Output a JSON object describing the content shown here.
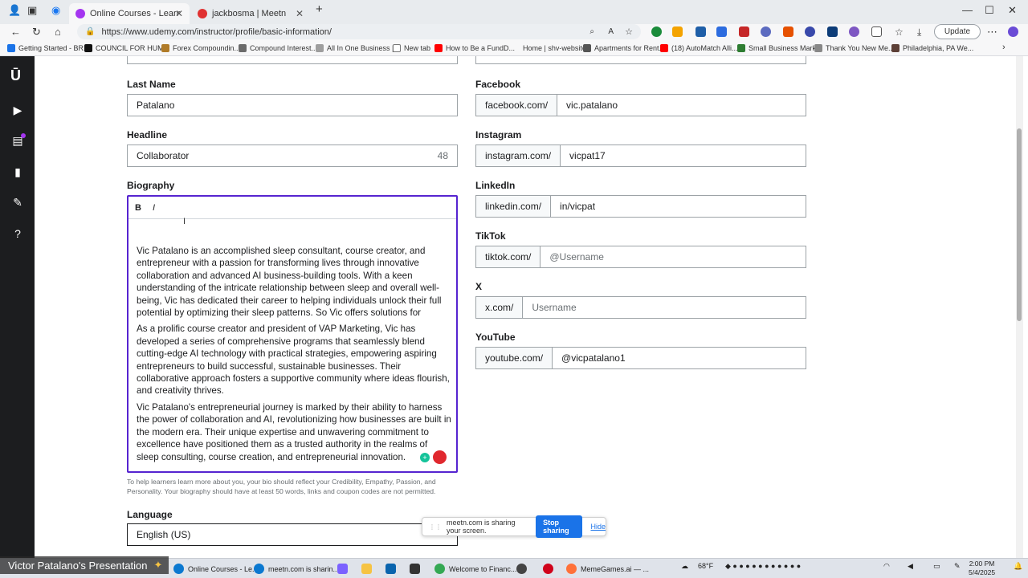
{
  "browser": {
    "tabs": [
      {
        "title": "Online Courses - Learn Anything,",
        "active": true
      },
      {
        "title": "jackbosma | Meetn",
        "active": false
      }
    ],
    "url": "https://www.udemy.com/instructor/profile/basic-information/",
    "update_label": "Update",
    "bookmarks": [
      "Getting Started - BR...",
      "COUNCIL FOR HUM...",
      "Forex Compoundin...",
      "Compound Interest...",
      "All In One Business |...",
      "New tab",
      "How to Be a FundD...",
      "Home | shv-website",
      "Apartments for Rent...",
      "(18) AutoMatch Alli...",
      "Small Business Mark...",
      "Thank You New Me...",
      "Philadelphia, PA We..."
    ]
  },
  "form": {
    "last_name": {
      "label": "Last Name",
      "value": "Patalano"
    },
    "headline": {
      "label": "Headline",
      "value": "Collaborator",
      "counter": "48"
    },
    "biography": {
      "label": "Biography",
      "bold_label": "B",
      "italic_label": "I",
      "paragraphs": [
        "Vic Patalano is an accomplished sleep consultant, course creator, and entrepreneur with a passion for transforming lives through innovative collaboration and advanced AI business-building tools. With a keen understanding of the intricate relationship between sleep and overall well-being, Vic has dedicated their career to helping individuals unlock their full potential by optimizing their sleep patterns.  So Vic offers solutions for",
        "As a prolific course creator and president of VAP Marketing, Vic has developed a series of comprehensive programs that seamlessly blend cutting-edge AI technology with practical strategies, empowering aspiring entrepreneurs to build successful, sustainable businesses. Their collaborative approach fosters a supportive community where ideas flourish, and creativity thrives.",
        "Vic Patalano's entrepreneurial journey is marked by their ability to harness the power of collaboration and AI, revolutionizing how businesses are built in the modern era. Their unique expertise and unwavering commitment to excellence have positioned them as a trusted authority in the realms of sleep consulting, course creation, and entrepreneurial innovation."
      ],
      "help_text": "To help learners learn more about you, your bio should reflect your Credibility, Empathy, Passion, and Personality. Your biography should have at least 50 words, links and coupon codes are not permitted."
    },
    "language": {
      "label": "Language",
      "value": "English (US)"
    },
    "facebook": {
      "label": "Facebook",
      "prefix": "facebook.com/",
      "value": "vic.patalano"
    },
    "instagram": {
      "label": "Instagram",
      "prefix": "instagram.com/",
      "value": "vicpat17"
    },
    "linkedin": {
      "label": "LinkedIn",
      "prefix": "linkedin.com/",
      "value": "in/vicpat"
    },
    "tiktok": {
      "label": "TikTok",
      "prefix": "tiktok.com/",
      "placeholder": "@Username"
    },
    "x": {
      "label": "X",
      "prefix": "x.com/",
      "placeholder": "Username"
    },
    "youtube": {
      "label": "YouTube",
      "prefix": "youtube.com/",
      "value": "@vicpatalano1"
    }
  },
  "share_bar": {
    "message": "meetn.com is sharing your screen.",
    "stop_label": "Stop sharing",
    "hide_label": "Hide"
  },
  "taskbar": {
    "presentation": "Victor Patalano's Presentation",
    "items": [
      "Online Courses - Le...",
      "meetn.com is sharin...",
      "Welcome to Financ...",
      "MemeGames.ai — ..."
    ],
    "weather": "68°F",
    "time": "2:00 PM",
    "date": "5/4/2025"
  },
  "colors": {
    "udemy_purple": "#5624d0",
    "sidebar_bg": "#1c1d1f",
    "share_blue": "#1a73e8"
  }
}
